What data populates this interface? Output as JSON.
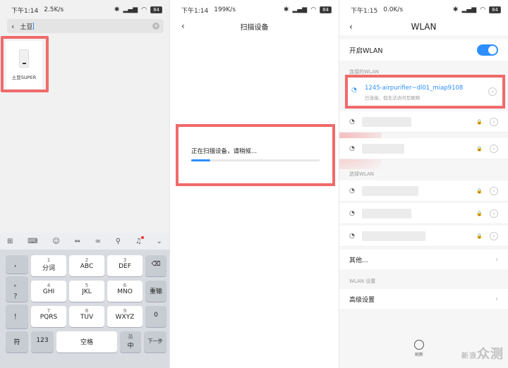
{
  "panel1": {
    "status": {
      "time": "下午1:14",
      "speed": "2.5K/s",
      "battery": "84"
    },
    "search": {
      "text": "土豆"
    },
    "app": {
      "label": "土豆SUPER"
    },
    "toolbar_icons": [
      "grid-icon",
      "keyboard-icon",
      "emoji-icon",
      "cursor-icon",
      "link-icon",
      "search-icon",
      "mic-icon",
      "chevron-down-icon"
    ],
    "keys": {
      "comma": "，",
      "period": "。",
      "question": "？",
      "exclaim": "！",
      "k1_num": "1",
      "k1_lbl": "分词",
      "k2_num": "2",
      "k2_lbl": "ABC",
      "k3_num": "3",
      "k3_lbl": "DEF",
      "k4_num": "4",
      "k4_lbl": "GHI",
      "k5_num": "5",
      "k5_lbl": "JKL",
      "k6_num": "6",
      "k6_lbl": "MNO",
      "k7_num": "7",
      "k7_lbl": "PQRS",
      "k8_num": "8",
      "k8_lbl": "TUV",
      "k9_num": "9",
      "k9_lbl": "WXYZ",
      "reenter": "重输",
      "zero": "0",
      "symbol": "符",
      "num123": "123",
      "space": "空格",
      "lang_top": "英",
      "lang_bottom": "中",
      "next": "下一步"
    }
  },
  "panel2": {
    "status": {
      "time": "下午1:14",
      "speed": "199K/s",
      "battery": "84"
    },
    "title": "扫描设备",
    "scan_text": "正在扫描设备，请稍候...",
    "progress": 0.15
  },
  "panel3": {
    "status": {
      "time": "下午1:15",
      "speed": "0.0K/s",
      "battery": "84"
    },
    "title": "WLAN",
    "toggle_label": "开启WLAN",
    "connected_section": "连接的WLAN",
    "connected_name": "1245-airpurifier~dl01_miap9108",
    "connected_status": "已连接，但无法访问互联网",
    "available_section": "选择WLAN",
    "other": "其他...",
    "settings_section": "WLAN 设置",
    "advanced": "高级设置",
    "refresh": "刷新",
    "watermark_a": "新",
    "watermark_b": "浪",
    "watermark_c": "众测"
  }
}
